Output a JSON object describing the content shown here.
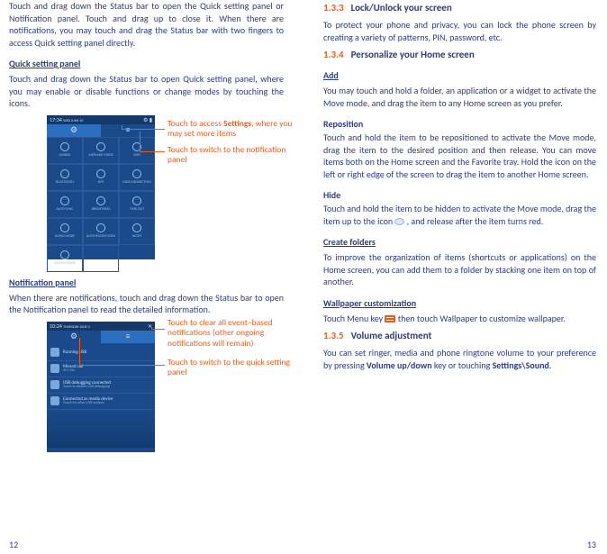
{
  "left": {
    "intro": "Touch and drag down the Status bar to open the Quick setting panel or Notification panel. Touch and drag up to close it. When there are notifications, you may touch and drag the Status bar with two fingers to access Quick setting panel directly.",
    "quick_heading": "Quick setting panel",
    "quick_body": "Touch and drag down the Status bar to open Quick setting panel, where you may enable or disable functions or change modes by touching the icons.",
    "callout1a": "Touch to access ",
    "callout1b": "Settings",
    "callout1c": ", where you may set more items",
    "callout2": "Touch to switch to the notification panel",
    "qs_time": "17:34",
    "qs_date": "WED JUNE 10",
    "qs_items": [
      "MOBILE",
      "AIRPLANE MODE",
      "WIFI",
      "BLUETOOTH",
      "GPS",
      "DATA CONNECTION",
      "AUTO-SYNC",
      "BRIGHTNESS",
      "TIME OUT",
      "AUDIO MODE",
      "AUTO ROTATE SCRN",
      "NIGHT",
      "SAVING MODE",
      ""
    ],
    "notif_heading": "Notification panel",
    "notif_body": "When there are notifications, touch and drag down the Status bar to open the Notification panel to read the detailed information.",
    "callout3": "Touch to clear all event–based notifications (other ongoing notifications will remain)",
    "callout4": "Touch to switch to the quick setting panel",
    "np_time": "10:24",
    "np_date": "THURSDAY JUNE 4",
    "np_rows": [
      {
        "t": "Running USB",
        "s": ""
      },
      {
        "t": "Missed call",
        "s": "451 434"
      },
      {
        "t": "USB debugging connected",
        "s": "Touch to disable USB debugging"
      },
      {
        "t": "Connected as media device",
        "s": "Touch for other USB options"
      }
    ],
    "page_num": "12"
  },
  "right": {
    "s133_num": "1.3.3",
    "s133_title": "Lock/Unlock your screen",
    "s133_body": "To protect your phone and privacy, you can lock the phone screen by creating a variety of patterns, PIN, password, etc.",
    "s134_num": "1.3.4",
    "s134_title": "Personalize your Home screen",
    "add_h": "Add",
    "add_b": "You may touch and hold a folder, an application or a widget to activate the Move mode, and drag the item to any Home screen as you prefer.",
    "rep_h": "Reposition",
    "rep_b": "Touch and hold the item to be repositioned to activate the Move mode, drag the item to the desired position and then release. You can move items both on the Home screen and the Favorite tray. Hold the icon on the left or right edge of the screen to drag the item to another Home screen.",
    "hide_h": "Hide",
    "hide_b1": "Touch and hold the item to be hidden to activate the Move mode, drag the item up to the icon ",
    "hide_b2": " , and release after the item turns red.",
    "cf_h": "Create folders",
    "cf_b": "To improve the organization of items (shortcuts or applications) on the Home screen, you can add them to a folder by stacking one item on top of another.",
    "wp_h": "Wallpaper customization",
    "wp_b1": "Touch Menu key ",
    "wp_b2": " then touch Wallpaper to customize wallpaper.",
    "s135_num": "1.3.5",
    "s135_title": "Volume adjustment",
    "s135_b1": "You can set ringer, media and phone ringtone volume to your preference by pressing ",
    "s135_b2": "Volume up/down",
    "s135_b3": " key or touching ",
    "s135_b4": "Settings\\Sound",
    "s135_b5": ".",
    "page_num": "13"
  }
}
